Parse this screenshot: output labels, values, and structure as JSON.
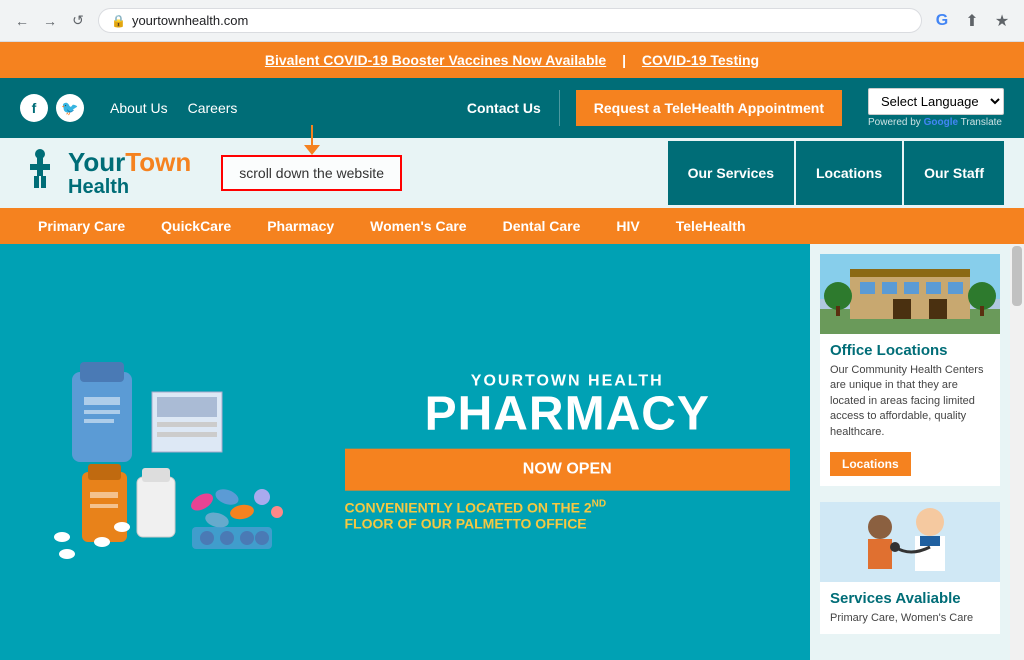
{
  "browser": {
    "url": "yourtownhealth.com",
    "back_label": "←",
    "forward_label": "→",
    "refresh_label": "↺",
    "google_icon": "G",
    "share_icon": "⬆",
    "star_icon": "★"
  },
  "top_banner": {
    "vaccine_text": "Bivalent COVID-19 Booster Vaccines Now Available",
    "separator": "|",
    "testing_text": "COVID-19 Testing"
  },
  "header": {
    "about_us": "About Us",
    "careers": "Careers",
    "contact_us": "Contact Us",
    "telehealth_btn": "Request a TeleHealth Appointment",
    "language_label": "Select Language",
    "powered_by": "Powered by",
    "google_label": "Google",
    "translate_label": "Translate"
  },
  "logo": {
    "your": "Your",
    "town": "Town",
    "health": "Health"
  },
  "annotation": {
    "text": "scroll down the website"
  },
  "nav": {
    "our_services": "Our Services",
    "locations": "Locations",
    "our_staff": "Our Staff"
  },
  "sub_nav": {
    "items": [
      "Primary Care",
      "QuickCare",
      "Pharmacy",
      "Women's Care",
      "Dental Care",
      "HIV",
      "TeleHealth"
    ]
  },
  "hero": {
    "subtitle": "YOURTOWN HEALTH",
    "title": "PHARMACY",
    "open_label": "NOW OPEN",
    "footer_text": "CONVENIENTLY LOCATED ON THE 2",
    "footer_sup": "ND",
    "footer_text2": "FLOOR OF OUR PALMETTO OFFICE"
  },
  "sidebar": {
    "office_locations_title": "Office Locations",
    "office_locations_text": "Our Community Health Centers are unique in that they are located in areas facing limited access to affordable, quality healthcare.",
    "locations_btn": "Locations",
    "services_title": "Services Avaliable",
    "services_subtitle": "Primary Care, Women's Care"
  }
}
